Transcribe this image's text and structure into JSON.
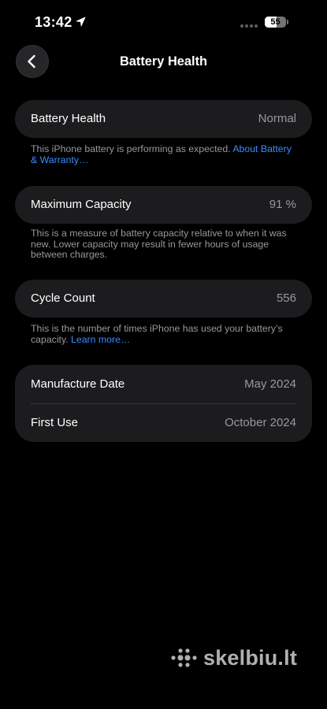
{
  "status_bar": {
    "time": "13:42",
    "battery": {
      "label": "55",
      "level": 0.55
    }
  },
  "nav": {
    "title": "Battery Health"
  },
  "sections": {
    "battery_health": {
      "label": "Battery Health",
      "value": "Normal",
      "footer_text": "This iPhone battery is performing as expected. ",
      "footer_link": "About Battery & Warranty…"
    },
    "maximum_capacity": {
      "label": "Maximum Capacity",
      "value": "91 %",
      "footer_text": "This is a measure of battery capacity relative to when it was new. Lower capacity may result in fewer hours of usage between charges."
    },
    "cycle_count": {
      "label": "Cycle Count",
      "value": "556",
      "footer_text": "This is the number of times iPhone has used your battery’s capacity. ",
      "footer_link": "Learn more…"
    },
    "dates": [
      {
        "label": "Manufacture Date",
        "value": "May 2024"
      },
      {
        "label": "First Use",
        "value": "October 2024"
      }
    ]
  },
  "watermark": {
    "text": "skelbiu.lt"
  },
  "icons": {
    "location": "location-arrow-icon",
    "signal": "signal-dots-icon",
    "battery": "battery-icon",
    "back": "chevron-left-icon",
    "watermark_logo": "skelbiu-dots-logo-icon"
  },
  "colors": {
    "background": "#000000",
    "card": "#1c1c1e",
    "secondary_text": "#98989e",
    "link": "#3b8cff",
    "separator": "#38383a",
    "button": "#262628",
    "watermark": "#cfcfcf"
  }
}
